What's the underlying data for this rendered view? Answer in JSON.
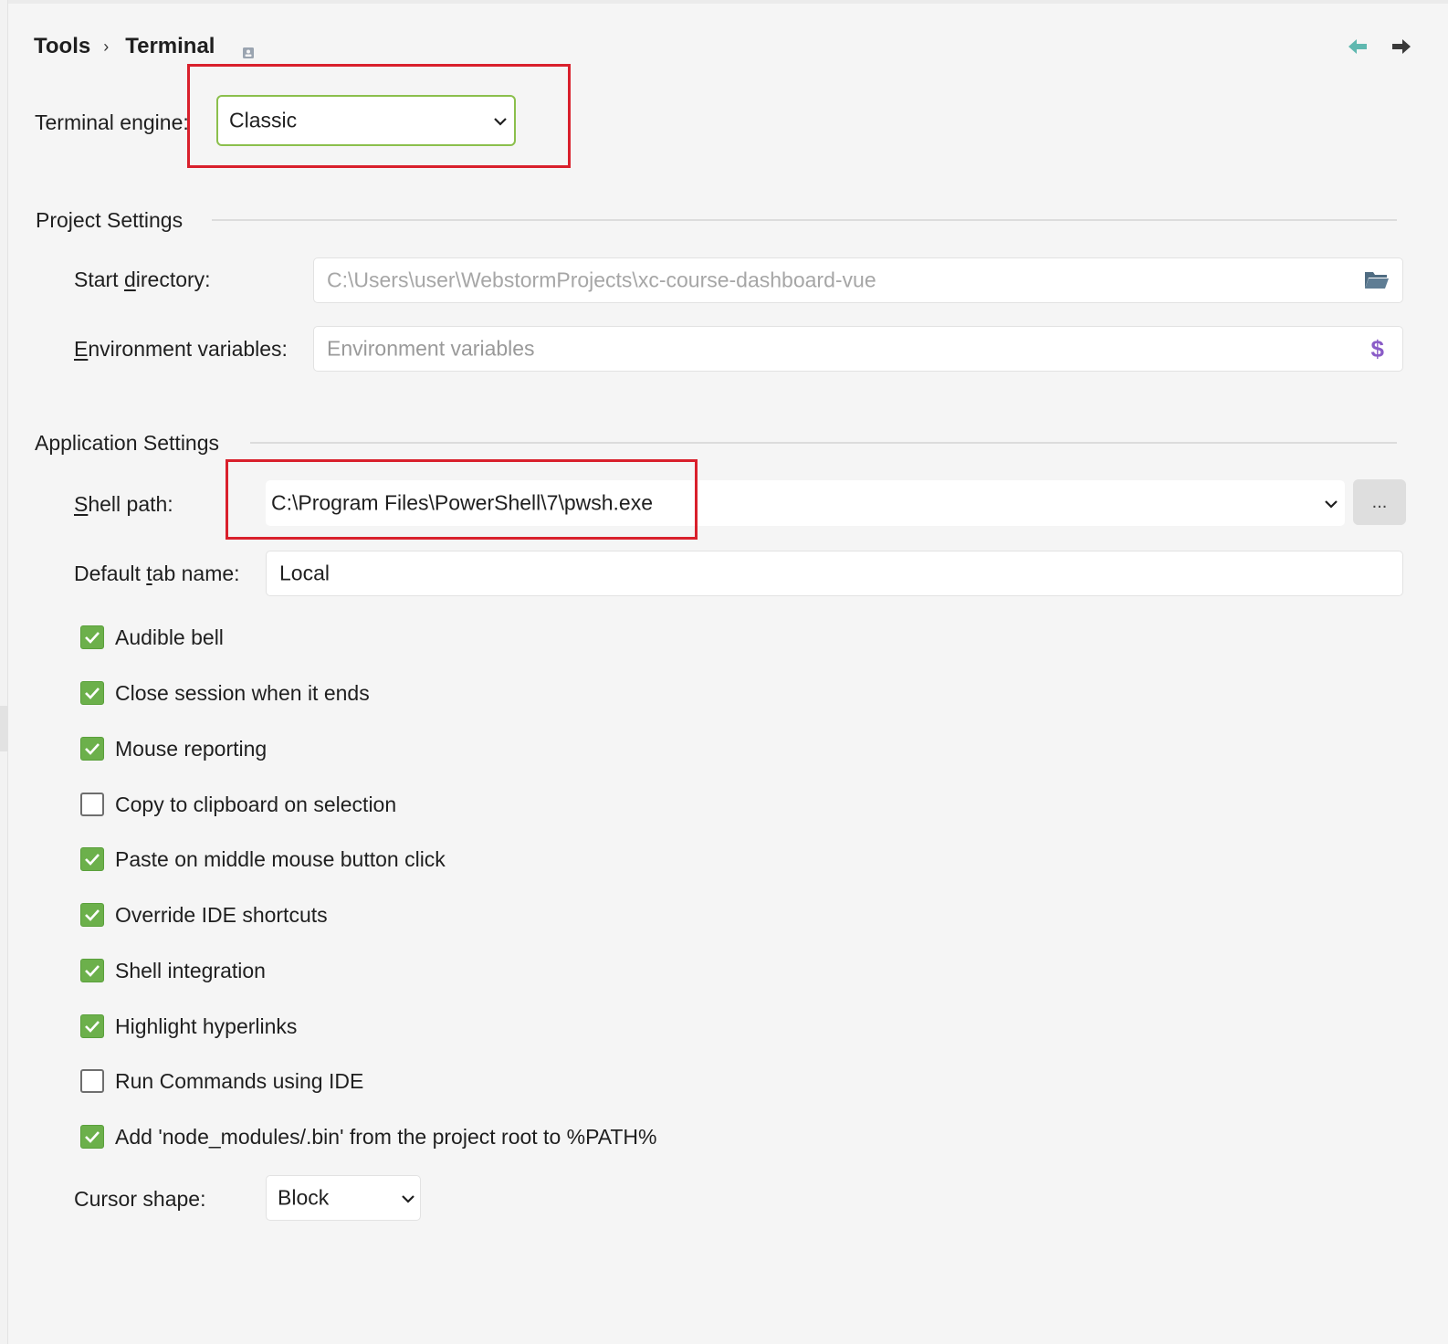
{
  "breadcrumb": {
    "parent": "Tools",
    "current": "Terminal",
    "separator": "›"
  },
  "icons": {
    "pin": "pin-icon",
    "back": "arrow-left-icon",
    "forward": "arrow-right-icon",
    "folder": "folder-icon",
    "dollar": "dollar-icon",
    "chevron": "chevron-down-icon"
  },
  "engine": {
    "label": "Terminal engine:",
    "value": "Classic"
  },
  "project_settings": {
    "title": "Project Settings",
    "start_directory_label_pre": "Start ",
    "start_directory_label_u": "d",
    "start_directory_label_post": "irectory:",
    "start_directory_value": "C:\\Users\\user\\WebstormProjects\\xc-course-dashboard-vue",
    "env_label_u": "E",
    "env_label_post": "nvironment variables:",
    "env_placeholder": "Environment variables",
    "dollar_glyph": "$"
  },
  "app_settings": {
    "title": "Application Settings",
    "shell_label_pre": "",
    "shell_label_u": "S",
    "shell_label_post": "hell path:",
    "shell_value": "C:\\Program Files\\PowerShell\\7\\pwsh.exe",
    "browse_label": "...",
    "tab_label_pre": "Default ",
    "tab_label_u": "t",
    "tab_label_post": "ab name:",
    "tab_value": "Local",
    "cursor_label": "Cursor shape:",
    "cursor_value": "Block"
  },
  "checkboxes": [
    {
      "label": "Audible bell",
      "checked": true
    },
    {
      "label": "Close session when it ends",
      "checked": true
    },
    {
      "label": "Mouse reporting",
      "checked": true
    },
    {
      "label": "Copy to clipboard on selection",
      "checked": false
    },
    {
      "label": "Paste on middle mouse button click",
      "checked": true
    },
    {
      "label": "Override IDE shortcuts",
      "checked": true
    },
    {
      "label": "Shell integration",
      "checked": true
    },
    {
      "label": "Highlight hyperlinks",
      "checked": true
    },
    {
      "label": "Run Commands using IDE",
      "checked": false
    },
    {
      "label": "Add 'node_modules/.bin' from the project root to %PATH%",
      "checked": true
    }
  ],
  "colors": {
    "accent_green": "#6cb04b",
    "focus_border": "#8bbf4c",
    "highlight_red": "#d9202c",
    "back_arrow": "#5fb8b0",
    "dollar": "#8a5cc7",
    "folder": "#4f6c82"
  }
}
